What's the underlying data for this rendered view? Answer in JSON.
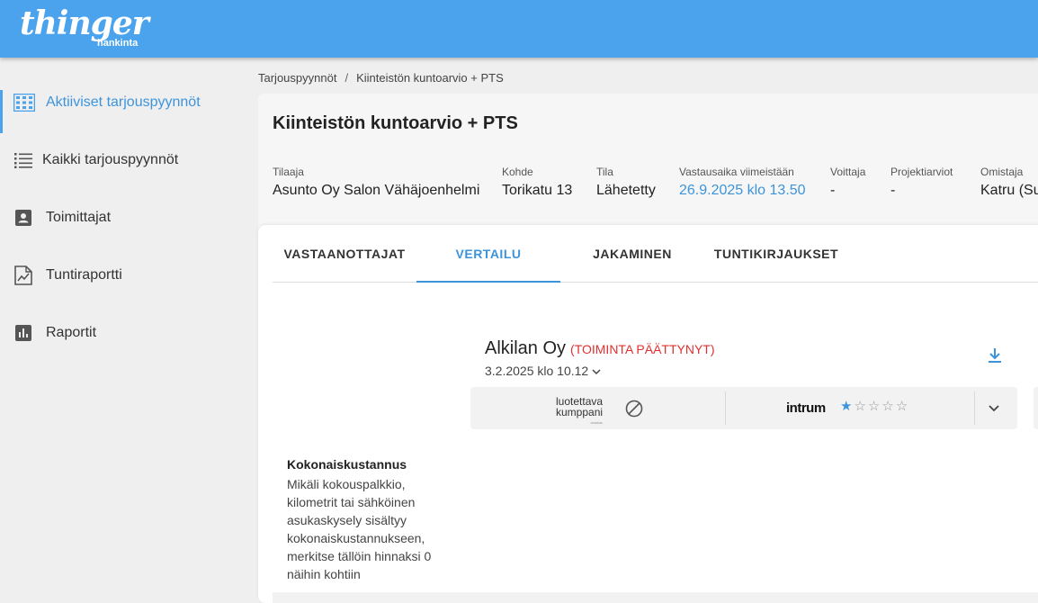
{
  "header": {
    "logo_text": "thinger",
    "logo_subtext": "hankinta",
    "brand_color": "#4aa3ec"
  },
  "sidebar": {
    "items": [
      {
        "label": "Aktiiviset tarjouspyynnöt",
        "icon": "grid-icon",
        "active": true
      },
      {
        "label": "Kaikki tarjouspyynnöt",
        "icon": "list-icon"
      },
      {
        "label": "Toimittajat",
        "icon": "contact-card-icon"
      },
      {
        "label": "Tuntiraportti",
        "icon": "report-chart-icon"
      },
      {
        "label": "Raportit",
        "icon": "bar-chart-icon"
      }
    ]
  },
  "breadcrumb": {
    "items": [
      "Tarjouspyynnöt",
      "Kiinteistön kuntoarvio + PTS"
    ],
    "separator": "/"
  },
  "page": {
    "title": "Kiinteistön kuntoarvio + PTS",
    "meta": [
      {
        "label": "Tilaaja",
        "value": "Asunto Oy Salon Vähäjoenhelmi"
      },
      {
        "label": "Kohde",
        "value": "Torikatu 13"
      },
      {
        "label": "Tila",
        "value": "Lähetetty"
      },
      {
        "label": "Vastausaika viimeistään",
        "value": "26.9.2025 klo 13.50"
      },
      {
        "label": "Voittaja",
        "value": "-"
      },
      {
        "label": "Projektiarviot",
        "value": "-"
      },
      {
        "label": "Omistaja",
        "value": "Katru (Su"
      }
    ]
  },
  "tabs": [
    {
      "label": "VASTAANOTTAJAT"
    },
    {
      "label": "VERTAILU",
      "active": true
    },
    {
      "label": "JAKAMINEN"
    },
    {
      "label": "TUNTIKIRJAUKSET"
    }
  ],
  "offer": {
    "company": "Alkilan Oy",
    "status": "(TOIMINTA PÄÄTTYNYT)",
    "date": "3.2.2025 klo 10.12",
    "luotettava_kumppani": {
      "line1": "luotettava",
      "line2": "kumppani",
      "line3": "asiakas",
      "status_icon": "blocked-icon"
    },
    "intrum": {
      "logo": "intrum",
      "rating": 1,
      "max_rating": 5
    }
  },
  "cost_section": {
    "title": "Kokonaiskustannus",
    "description": "Mikäli kokouspalkkio, kilometrit tai sähköinen asukaskysely sisältyy kokonaiskustannukseen, merkitse tällöin hinnaksi 0 näihin kohtiin"
  },
  "colors": {
    "accent": "#3d94db",
    "status_red": "#e0302f"
  }
}
